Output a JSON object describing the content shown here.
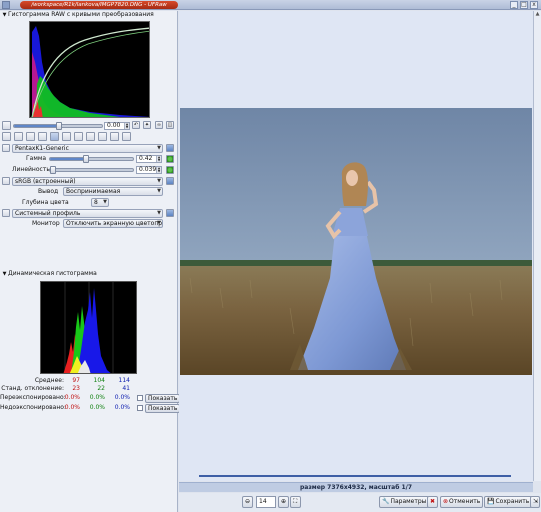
{
  "window": {
    "title": "/workspace/R1k/lankova/IMGP7820.DNG - UFRaw",
    "close_glyph": "x",
    "max_glyph": "□",
    "min_glyph": "_"
  },
  "raw_histogram": {
    "header": "Гистограмма RAW с кривыми преобразования"
  },
  "exposure": {
    "value": "0.00"
  },
  "camera_profile": {
    "name": "PentaxK1-Generic",
    "gamma_label": "Гамма",
    "gamma_value": "0.42",
    "gamma_fraction": 0.42,
    "linearity_label": "Линейность",
    "linearity_value": "0.039",
    "linearity_fraction": 0.039
  },
  "output_profile": {
    "name": "sRGB (встроенный)",
    "intent_label": "Вывод",
    "intent_value": "Воспринимаемая",
    "depth_label": "Глубина цвета",
    "depth_value": "8"
  },
  "display_profile": {
    "name": "Системный профиль",
    "monitor_label": "Монитор",
    "monitor_value": "Отключить экранную цветопр"
  },
  "dynamic_histogram": {
    "header": "Динамическая гистограмма",
    "mean_label": "Среднее:",
    "mean": [
      "97",
      "104",
      "114"
    ],
    "std_label": "Станд. отклонение:",
    "std": [
      "23",
      "22",
      "41"
    ],
    "over_label": "Переэкспонировано:",
    "over": [
      "0.0%",
      "0.0%",
      "0.0%"
    ],
    "under_label": "Недоэкспонировано:",
    "under": [
      "0.0%",
      "0.0%",
      "0.0%"
    ],
    "show_label": "Показать"
  },
  "viewer": {
    "status": "размер 7376x4932, масштаб 1/7"
  },
  "bottom": {
    "zoom_value": "14",
    "params_label": "Параметры",
    "cancel_label": "Отменить",
    "save_label": "Сохранить"
  },
  "colors": {
    "accent": "#3e5fa6",
    "title_bar": "#c0391b",
    "status_bar": "#bfcce3"
  }
}
